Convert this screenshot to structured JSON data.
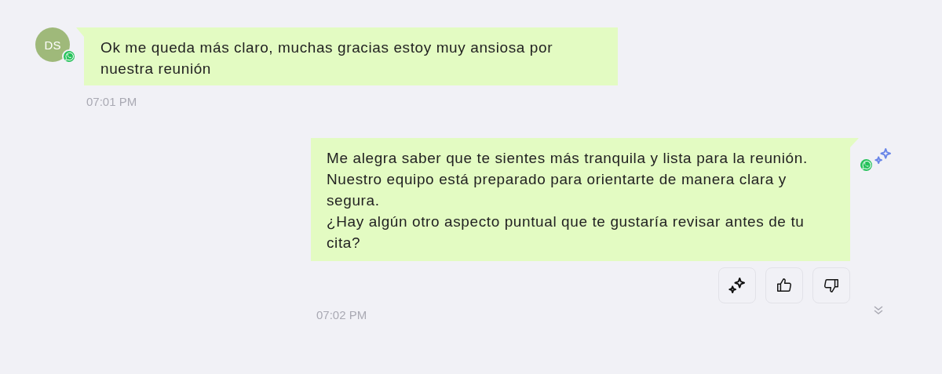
{
  "messages": [
    {
      "kind": "incoming",
      "avatar": "DS",
      "text": "Ok me queda más claro, muchas gracias estoy muy ansiosa por nuestra reunión",
      "time": "07:01 PM"
    },
    {
      "kind": "outgoing",
      "text": "Me alegra saber que te sientes más tranquila y lista para la reunión.\nNuestro equipo está preparado para orientarte de manera clara y segura.\n¿Hay algún otro aspecto puntual que te gustaría revisar antes de tu cita?",
      "time": "07:02 PM"
    }
  ]
}
